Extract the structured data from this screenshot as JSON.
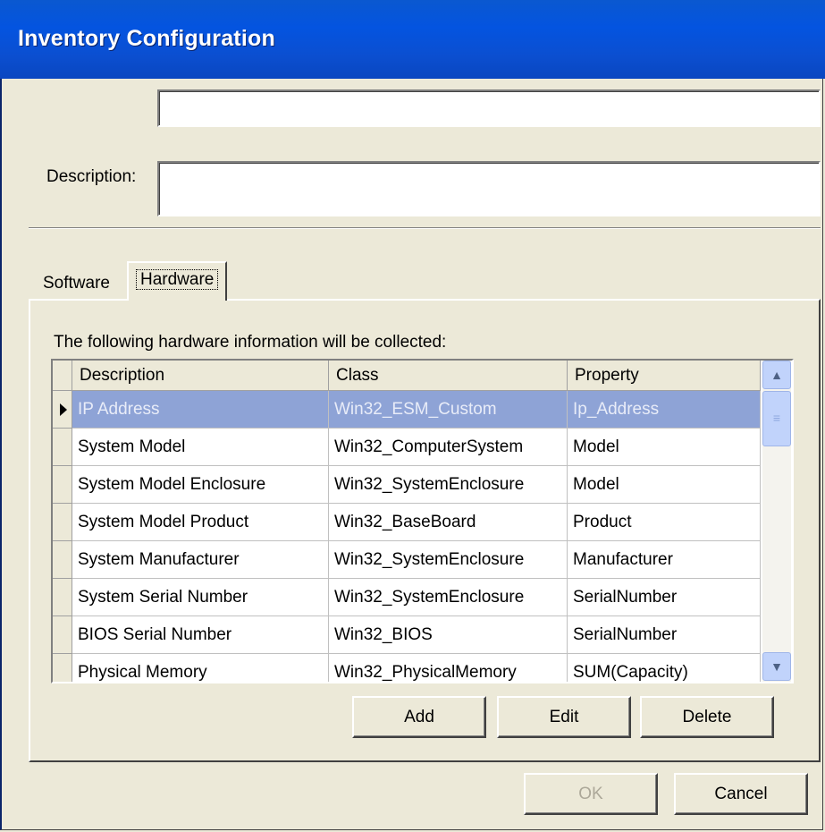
{
  "window": {
    "title": "Inventory Configuration"
  },
  "form": {
    "name_value": "",
    "description_label": "Description:",
    "description_value": ""
  },
  "tabs": [
    {
      "label": "Software",
      "active": false
    },
    {
      "label": "Hardware",
      "active": true
    }
  ],
  "hardware": {
    "caption": "The following hardware information will be collected:",
    "columns": [
      "Description",
      "Class",
      "Property"
    ],
    "rows": [
      {
        "description": "IP Address",
        "class": "Win32_ESM_Custom",
        "property": "Ip_Address",
        "selected": true
      },
      {
        "description": "System Model",
        "class": "Win32_ComputerSystem",
        "property": "Model"
      },
      {
        "description": "System Model Enclosure",
        "class": "Win32_SystemEnclosure",
        "property": "Model"
      },
      {
        "description": "System Model Product",
        "class": "Win32_BaseBoard",
        "property": "Product"
      },
      {
        "description": "System Manufacturer",
        "class": "Win32_SystemEnclosure",
        "property": "Manufacturer"
      },
      {
        "description": "System Serial Number",
        "class": "Win32_SystemEnclosure",
        "property": "SerialNumber"
      },
      {
        "description": "BIOS Serial Number",
        "class": "Win32_BIOS",
        "property": "SerialNumber"
      },
      {
        "description": "Physical Memory",
        "class": "Win32_PhysicalMemory",
        "property": "SUM(Capacity)"
      }
    ],
    "buttons": {
      "add": "Add",
      "edit": "Edit",
      "delete": "Delete"
    }
  },
  "footer": {
    "ok": "OK",
    "cancel": "Cancel"
  },
  "colors": {
    "titlebar": "#0454e0",
    "selection": "#8ea3d6",
    "dialog": "#ece9d8"
  },
  "icons": {
    "scroll_up": "chevron-up-icon",
    "scroll_down": "chevron-down-icon",
    "current_row": "row-pointer-icon"
  }
}
